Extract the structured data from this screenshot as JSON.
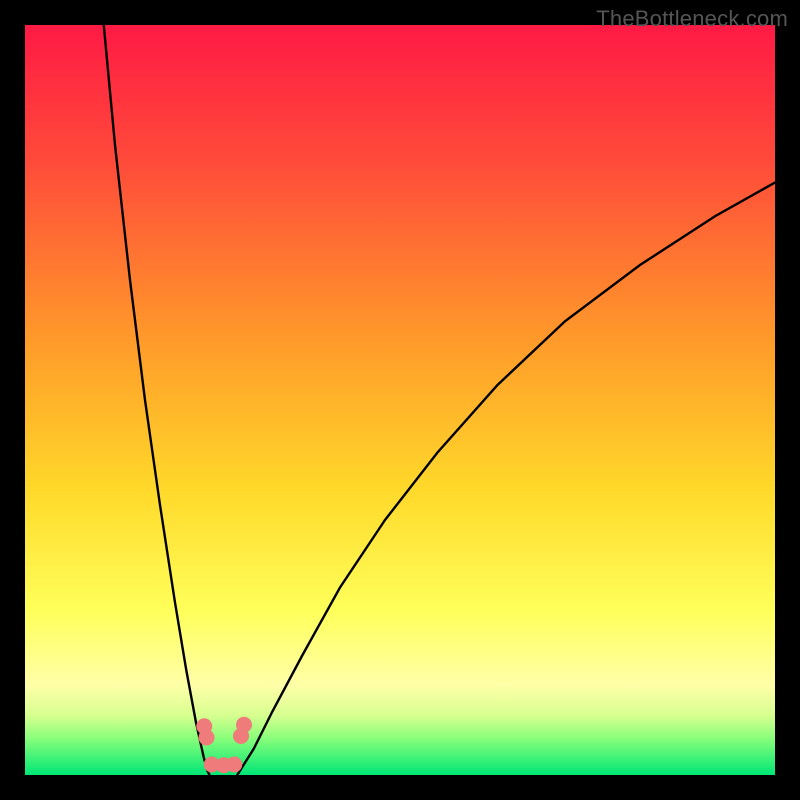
{
  "watermark": "TheBottleneck.com",
  "chart_data": {
    "type": "line",
    "title": "",
    "xlabel": "",
    "ylabel": "",
    "xlim": [
      0,
      100
    ],
    "ylim": [
      0,
      100
    ],
    "grid": false,
    "legend": false,
    "background_gradient_stops": [
      {
        "offset": 0.0,
        "color": "#ff1a44"
      },
      {
        "offset": 0.18,
        "color": "#ff4a3a"
      },
      {
        "offset": 0.42,
        "color": "#ff9a2a"
      },
      {
        "offset": 0.62,
        "color": "#ffd92a"
      },
      {
        "offset": 0.78,
        "color": "#ffff5a"
      },
      {
        "offset": 0.88,
        "color": "#ffffa8"
      },
      {
        "offset": 0.92,
        "color": "#d8ff90"
      },
      {
        "offset": 0.95,
        "color": "#8bff7a"
      },
      {
        "offset": 1.0,
        "color": "#00e676"
      }
    ],
    "series": [
      {
        "name": "left-curve",
        "x": [
          10.5,
          12.0,
          14.0,
          16.0,
          18.0,
          20.0,
          21.5,
          22.8,
          23.8,
          24.3,
          24.6
        ],
        "y": [
          100.0,
          84.0,
          66.0,
          50.0,
          36.0,
          23.0,
          14.0,
          7.0,
          2.5,
          0.6,
          0.0
        ]
      },
      {
        "name": "right-curve",
        "x": [
          28.3,
          28.8,
          30.5,
          33.0,
          37.0,
          42.0,
          48.0,
          55.0,
          63.0,
          72.0,
          82.0,
          92.0,
          100.0
        ],
        "y": [
          0.0,
          0.8,
          3.5,
          8.5,
          16.0,
          25.0,
          34.0,
          43.0,
          52.0,
          60.5,
          68.0,
          74.5,
          79.0
        ]
      }
    ],
    "markers": [
      {
        "name": "left-lobe-top",
        "x": 23.9,
        "y": 6.5
      },
      {
        "name": "left-lobe-upper",
        "x": 24.2,
        "y": 5.0
      },
      {
        "name": "valley-left",
        "x": 24.9,
        "y": 1.4
      },
      {
        "name": "valley-mid",
        "x": 26.5,
        "y": 1.3
      },
      {
        "name": "valley-right",
        "x": 27.9,
        "y": 1.4
      },
      {
        "name": "right-lobe-upper",
        "x": 28.8,
        "y": 5.2
      },
      {
        "name": "right-lobe-top",
        "x": 29.2,
        "y": 6.7
      }
    ],
    "marker_style": {
      "color": "#ef7b7b",
      "radius_px": 8
    }
  }
}
